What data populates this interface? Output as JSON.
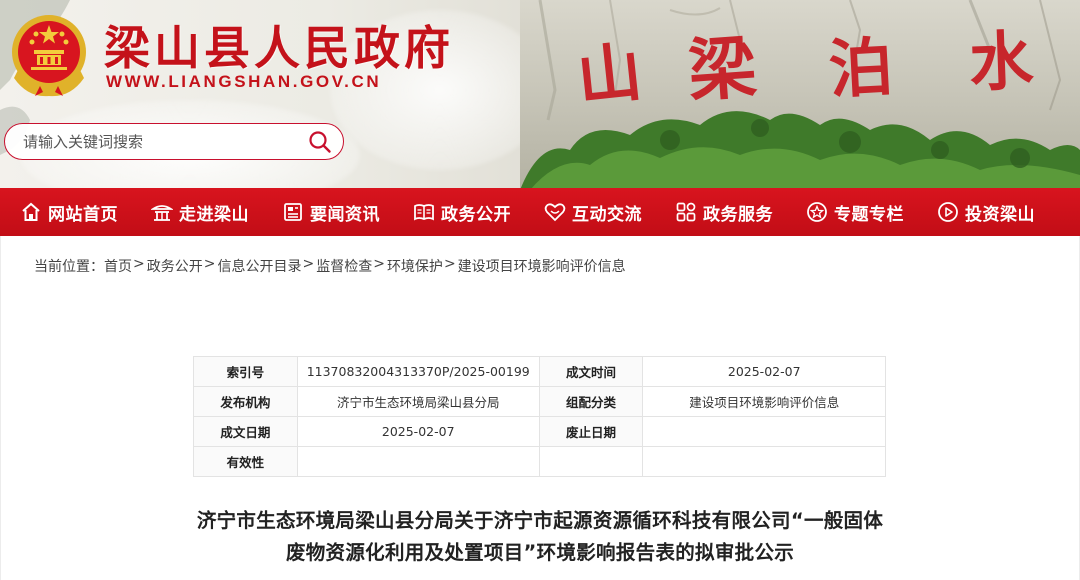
{
  "header": {
    "site_title": "梁山县人民政府",
    "site_url": "WWW.LIANGSHAN.GOV.CN",
    "banner_calligraphy": "山梁泊水"
  },
  "search": {
    "placeholder": "请输入关键词搜索"
  },
  "nav": {
    "items": [
      {
        "label": "网站首页",
        "icon": "home-icon"
      },
      {
        "label": "走进梁山",
        "icon": "pavilion-icon"
      },
      {
        "label": "要闻资讯",
        "icon": "news-icon"
      },
      {
        "label": "政务公开",
        "icon": "open-book-icon"
      },
      {
        "label": "互动交流",
        "icon": "heart-chat-icon"
      },
      {
        "label": "政务服务",
        "icon": "service-grid-icon"
      },
      {
        "label": "专题专栏",
        "icon": "star-circle-icon"
      },
      {
        "label": "投资梁山",
        "icon": "play-circle-icon"
      }
    ],
    "background_color": "#c8121b"
  },
  "breadcrumb": {
    "prefix": "当前位置：",
    "items": [
      "首页",
      "政务公开",
      "信息公开目录",
      "监督检查",
      "环境保护",
      "建设项目环境影响评价信息"
    ],
    "separator": ">"
  },
  "meta": {
    "rows": [
      {
        "k1": "索引号",
        "v1": "11370832004313370P/2025-00199",
        "k2": "成文时间",
        "v2": "2025-02-07"
      },
      {
        "k1": "发布机构",
        "v1": "济宁市生态环境局梁山县分局",
        "k2": "组配分类",
        "v2": "建设项目环境影响评价信息"
      },
      {
        "k1": "成文日期",
        "v1": "2025-02-07",
        "k2": "废止日期",
        "v2": ""
      },
      {
        "k1": "有效性",
        "v1": "",
        "k2": "",
        "v2": ""
      }
    ]
  },
  "document": {
    "title_line1": "济宁市生态环境局梁山县分局关于济宁市起源资源循环科技有限公司“一般固体",
    "title_line2": "废物资源化利用及处置项目”环境影响报告表的拟审批公示"
  },
  "colors": {
    "brand_red": "#c4121a",
    "nav_red": "#c8121b",
    "text": "#333333"
  }
}
